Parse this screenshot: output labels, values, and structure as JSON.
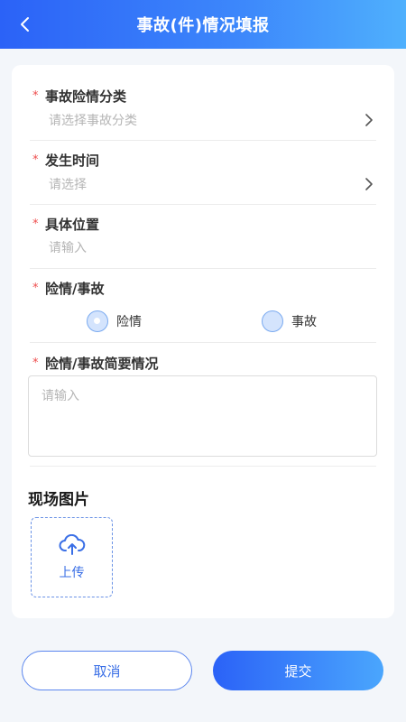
{
  "header": {
    "title": "事故(件)情况填报",
    "back_icon": "chevron-left-icon"
  },
  "form": {
    "category": {
      "required_mark": "*",
      "label": "事故险情分类",
      "placeholder": "请选择事故分类"
    },
    "time": {
      "required_mark": "*",
      "label": "发生时间",
      "placeholder": "请选择"
    },
    "location": {
      "required_mark": "*",
      "label": "具体位置",
      "placeholder": "请输入"
    },
    "type": {
      "required_mark": "*",
      "label": "险情/事故",
      "options": [
        {
          "label": "险情",
          "checked": true
        },
        {
          "label": "事故",
          "checked": false
        }
      ]
    },
    "summary": {
      "required_mark": "*",
      "label": "险情/事故简要情况",
      "placeholder": "请输入"
    }
  },
  "photos": {
    "title": "现场图片",
    "upload_label": "上传",
    "upload_icon": "cloud-upload-icon"
  },
  "actions": {
    "cancel_label": "取消",
    "submit_label": "提交"
  },
  "colors": {
    "primary": "#2b62f7",
    "primary_light": "#4fb0fd",
    "required": "#ee4c4c",
    "placeholder": "#b5b5b5",
    "background": "#f3f6fa"
  }
}
